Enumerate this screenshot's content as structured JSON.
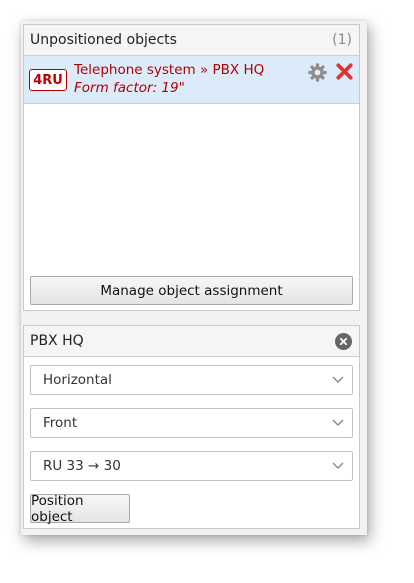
{
  "unpositioned": {
    "title": "Unpositioned objects",
    "count": "(1)",
    "object": {
      "badge": "4RU",
      "title": "Telephone system » PBX HQ",
      "subtitle": "Form factor: 19\"",
      "badge_color": "#c00000"
    },
    "manage_button": "Manage object assignment"
  },
  "placement": {
    "title": "PBX HQ",
    "orientation": "Horizontal",
    "side": "Front",
    "range": "RU 33 → 30",
    "position_button": "Position object"
  }
}
